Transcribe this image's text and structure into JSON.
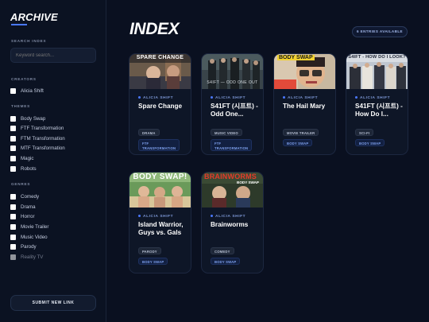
{
  "sidebar": {
    "brand": "ARCHIVE",
    "search": {
      "label": "SEARCH INDEX",
      "placeholder": "Keyword search..."
    },
    "creators": {
      "label": "CREATORS",
      "items": [
        "Alicia Shift"
      ]
    },
    "themes": {
      "label": "THEMES",
      "items": [
        "Body Swap",
        "FTF Transformation",
        "FTM Transformation",
        "MTF Transformation",
        "Magic",
        "Robots"
      ]
    },
    "genres": {
      "label": "GENRES",
      "items": [
        "Comedy",
        "Drama",
        "Horror",
        "Movie Trailer",
        "Music Video",
        "Parody",
        "Reality TV"
      ]
    },
    "submit_label": "SUBMIT NEW LINK"
  },
  "main": {
    "title": "INDEX",
    "entries_badge": "6 ENTRIES AVAILABLE",
    "cards": [
      {
        "thumb_text": "SPARE CHANGE",
        "creator": "ALICIA SHIFT",
        "title": "Spare Change",
        "tags": [
          "DRAMA",
          "FTF TRANSFORMATION"
        ]
      },
      {
        "thumb_text": "S4IFT — ODD ONE OUT",
        "creator": "ALICIA SHIFT",
        "title": "S41FT (시프트) - Odd One...",
        "tags": [
          "MUSIC VIDEO",
          "FTF TRANSFORMATION"
        ]
      },
      {
        "thumb_text": "BODY SWAP",
        "creator": "ALICIA SHIFT",
        "title": "The Hail Mary",
        "tags": [
          "MOVIE TRAILER",
          "BODY SWAP"
        ]
      },
      {
        "thumb_text": "S4IFT - HOW DO I LOOK?",
        "creator": "ALICIA SHIFT",
        "title": "S41FT (시프트) - How Do I...",
        "tags": [
          "SCI-FI",
          "BODY SWAP"
        ]
      },
      {
        "thumb_text": "BODY SWAP!",
        "creator": "ALICIA SHIFT",
        "title": "Island Warrior, Guys vs. Gals",
        "tags": [
          "PARODY",
          "BODY SWAP"
        ]
      },
      {
        "thumb_text": "BRAINWORMS",
        "thumb_subtext": "BODY SWAP",
        "creator": "ALICIA SHIFT",
        "title": "Brainworms",
        "tags": [
          "COMEDY",
          "BODY SWAP"
        ]
      }
    ]
  },
  "colors": {
    "background": "#0a1020",
    "accent": "#4a78ff",
    "tag_blue": "#7ea0ee"
  }
}
